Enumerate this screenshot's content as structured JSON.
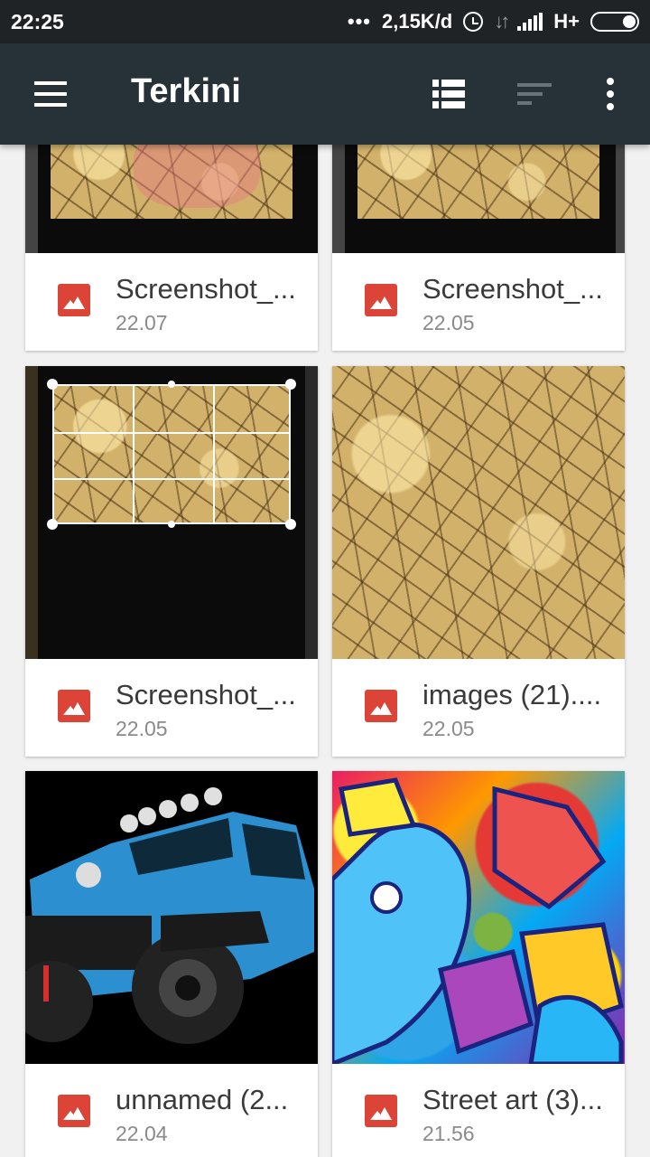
{
  "status_bar": {
    "time": "22:25",
    "dots": "•••",
    "net_speed": "2,15K/d",
    "network_type": "H+",
    "icons": [
      "alarm-icon",
      "data-arrows-icon",
      "signal-icon",
      "battery-icon"
    ]
  },
  "app_bar": {
    "title": "Terkini",
    "icons": [
      "menu-icon",
      "list-view-icon",
      "sort-icon",
      "more-vert-icon"
    ]
  },
  "files": [
    {
      "name": "Screenshot_...",
      "time": "22.07",
      "thumbnail": "cracked-earth-crop-pink"
    },
    {
      "name": "Screenshot_...",
      "time": "22.05",
      "thumbnail": "cracked-earth-crop"
    },
    {
      "name": "Screenshot_...",
      "time": "22.05",
      "thumbnail": "crop-editor-cracked-earth"
    },
    {
      "name": "images (21)....",
      "time": "22.05",
      "thumbnail": "cracked-earth"
    },
    {
      "name": "unnamed (2...",
      "time": "22.04",
      "thumbnail": "blue-jeep"
    },
    {
      "name": "Street art (3)...",
      "time": "21.56",
      "thumbnail": "graffiti"
    }
  ],
  "colors": {
    "status_bar": "#1f2326",
    "app_bar": "#263238",
    "image_icon": "#db4437",
    "background": "#f1f1f1"
  }
}
